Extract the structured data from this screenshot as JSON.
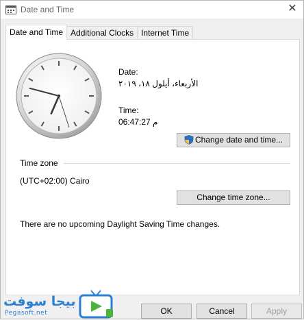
{
  "window": {
    "title": "Date and Time",
    "close_glyph": "✕"
  },
  "tabs": [
    {
      "label": "Date and Time",
      "active": true
    },
    {
      "label": "Additional Clocks",
      "active": false
    },
    {
      "label": "Internet Time",
      "active": false
    }
  ],
  "date": {
    "label": "Date:",
    "value": "الأربعاء، أيلول ١٨، ٢٠١٩"
  },
  "time": {
    "label": "Time:",
    "value": "06:47:27 م"
  },
  "clock": {
    "hour": 6,
    "minute": 47,
    "second": 27
  },
  "buttons": {
    "change_date_time": "Change date and time...",
    "change_time_zone": "Change time zone...",
    "ok": "OK",
    "cancel": "Cancel",
    "apply": "Apply"
  },
  "timezone": {
    "section_label": "Time zone",
    "value": "(UTC+02:00) Cairo",
    "dst_message": "There are no upcoming Daylight Saving Time changes."
  },
  "watermark": {
    "name": "بيجا سوفت",
    "url": "Pegasoft.net"
  },
  "colors": {
    "accent": "#2a7fd4",
    "button_bg": "#e1e1e1",
    "panel_bg": "#ffffff"
  }
}
